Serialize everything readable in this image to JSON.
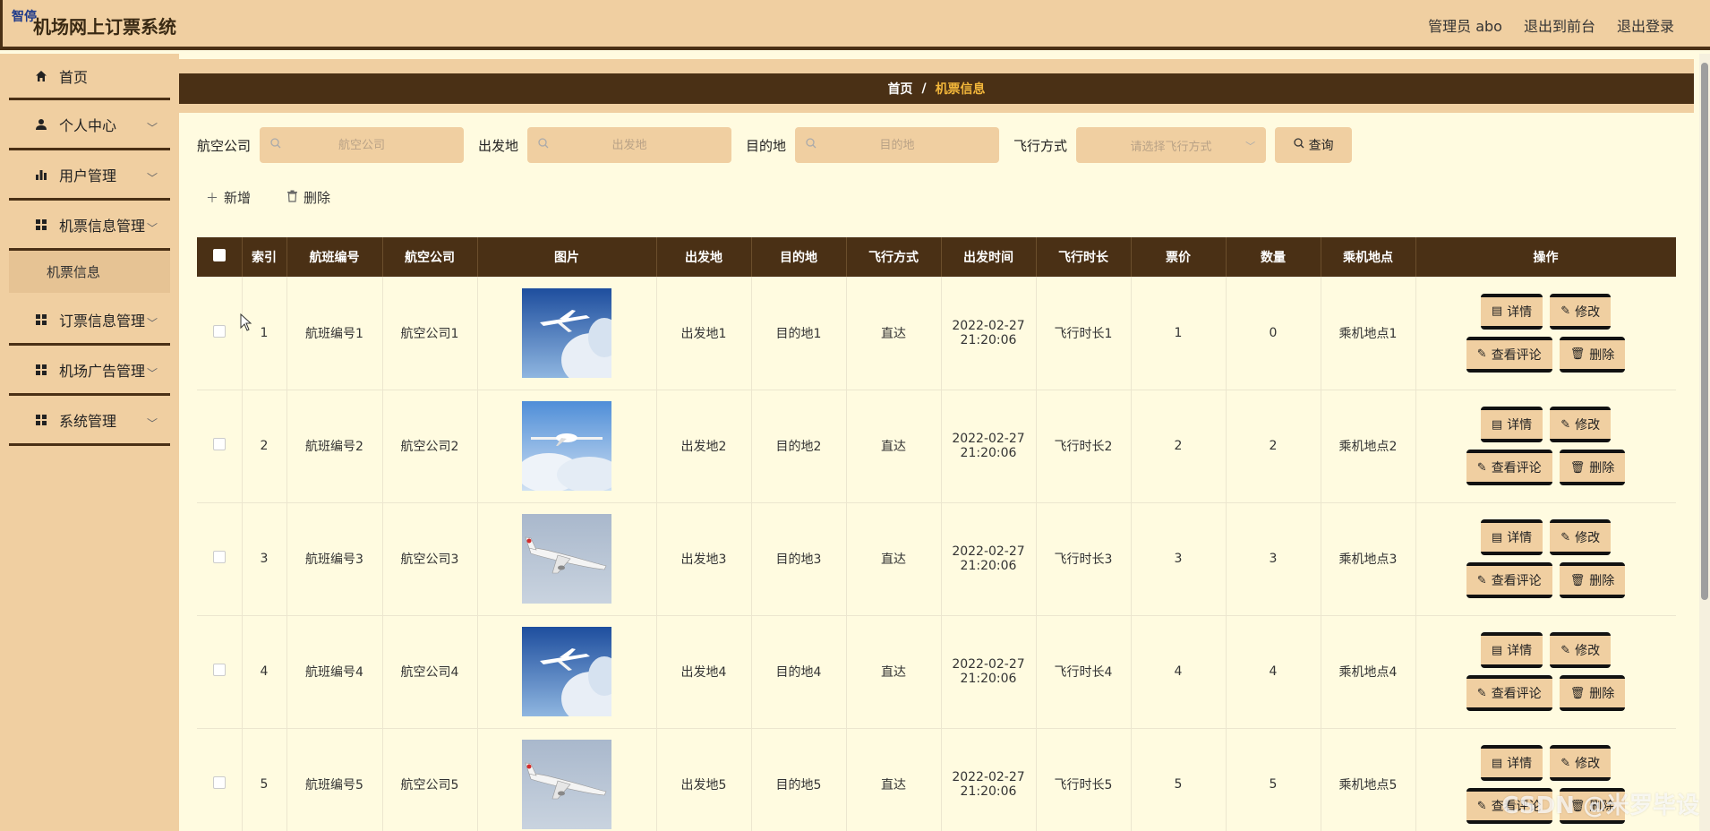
{
  "header": {
    "logo_tag": "智停",
    "title": "机场网上订票系统",
    "admin": "管理员 abo",
    "to_front": "退出到前台",
    "logout": "退出登录"
  },
  "sidebar": {
    "home": "首页",
    "items": [
      {
        "label": "个人中心"
      },
      {
        "label": "用户管理"
      },
      {
        "label": "机票信息管理"
      },
      {
        "label": "订票信息管理"
      },
      {
        "label": "机场广告管理"
      },
      {
        "label": "系统管理"
      }
    ],
    "sub_item": "机票信息"
  },
  "breadcrumb": {
    "home": "首页",
    "sep": "/",
    "current": "机票信息"
  },
  "search": {
    "airline_label": "航空公司",
    "airline_placeholder": "航空公司",
    "origin_label": "出发地",
    "origin_placeholder": "出发地",
    "dest_label": "目的地",
    "dest_placeholder": "目的地",
    "mode_label": "飞行方式",
    "mode_placeholder": "请选择飞行方式",
    "query_button": "查询"
  },
  "actions": {
    "add": "新增",
    "delete": "删除"
  },
  "table": {
    "columns": [
      "",
      "索引",
      "航班编号",
      "航空公司",
      "图片",
      "出发地",
      "目的地",
      "飞行方式",
      "出发时间",
      "飞行时长",
      "票价",
      "数量",
      "乘机地点",
      "操作"
    ],
    "ops": {
      "detail": "详情",
      "edit": "修改",
      "comments": "查看评论",
      "delete": "删除"
    },
    "rows": [
      {
        "index": "1",
        "flight_no": "航班编号1",
        "airline": "航空公司1",
        "image": "plane-blue-sky",
        "origin": "出发地1",
        "dest": "目的地1",
        "mode": "直达",
        "date": "2022-02-27",
        "time": "21:20:06",
        "duration": "飞行时长1",
        "price": "1",
        "qty": "0",
        "boarding": "乘机地点1"
      },
      {
        "index": "2",
        "flight_no": "航班编号2",
        "airline": "航空公司2",
        "image": "plane-clouds",
        "origin": "出发地2",
        "dest": "目的地2",
        "mode": "直达",
        "date": "2022-02-27",
        "time": "21:20:06",
        "duration": "飞行时长2",
        "price": "2",
        "qty": "2",
        "boarding": "乘机地点2"
      },
      {
        "index": "3",
        "flight_no": "航班编号3",
        "airline": "航空公司3",
        "image": "plane-airliner",
        "origin": "出发地3",
        "dest": "目的地3",
        "mode": "直达",
        "date": "2022-02-27",
        "time": "21:20:06",
        "duration": "飞行时长3",
        "price": "3",
        "qty": "3",
        "boarding": "乘机地点3"
      },
      {
        "index": "4",
        "flight_no": "航班编号4",
        "airline": "航空公司4",
        "image": "plane-blue-sky",
        "origin": "出发地4",
        "dest": "目的地4",
        "mode": "直达",
        "date": "2022-02-27",
        "time": "21:20:06",
        "duration": "飞行时长4",
        "price": "4",
        "qty": "4",
        "boarding": "乘机地点4"
      },
      {
        "index": "5",
        "flight_no": "航班编号5",
        "airline": "航空公司5",
        "image": "plane-airliner",
        "origin": "出发地5",
        "dest": "目的地5",
        "mode": "直达",
        "date": "2022-02-27",
        "time": "21:20:06",
        "duration": "飞行时长5",
        "price": "5",
        "qty": "5",
        "boarding": "乘机地点5"
      }
    ]
  },
  "watermark": "CSDN @米罗毕设",
  "colors": {
    "brown": "#4a3015",
    "tan": "#f0cfa1",
    "cream": "#fffbe0",
    "gold": "#f2b63a"
  }
}
